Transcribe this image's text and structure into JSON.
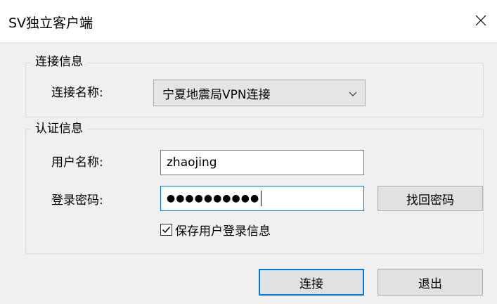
{
  "window": {
    "title": "SV独立客户端",
    "close_icon": "close-icon"
  },
  "connection_group": {
    "title": "连接信息",
    "name_label": "连接名称:",
    "name_value": "宁夏地震局VPN连接"
  },
  "auth_group": {
    "title": "认证信息",
    "username_label": "用户名称:",
    "username_value": "zhaojing",
    "password_label": "登录密码:",
    "password_mask": "●●●●●●●●●●",
    "recover_button": "找回密码",
    "remember_checked": true,
    "remember_label": "保存用户登录信息"
  },
  "footer": {
    "connect_button": "连接",
    "exit_button": "退出"
  },
  "colors": {
    "accent": "#0078d7",
    "panel_bg": "#f0f0f0",
    "button_bg": "#e1e1e1"
  }
}
